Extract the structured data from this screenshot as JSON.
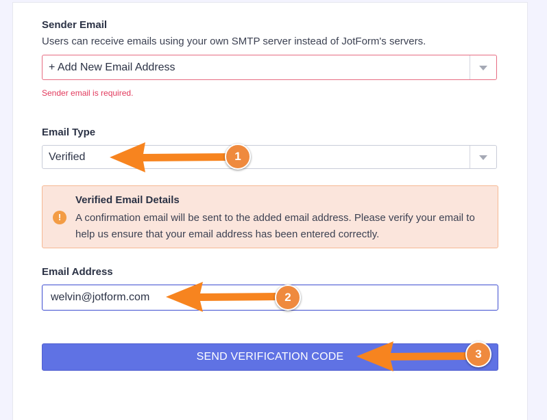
{
  "sender_email": {
    "label": "Sender Email",
    "description": "Users can receive emails using your own SMTP server instead of JotForm's servers.",
    "selected_value": "+ Add New Email Address",
    "error": "Sender email is required."
  },
  "email_type": {
    "label": "Email Type",
    "selected_value": "Verified"
  },
  "notice": {
    "title": "Verified Email Details",
    "body": "A confirmation email will be sent to the added email address. Please verify your email to help us ensure that your email address has been entered correctly.",
    "icon": "exclamation"
  },
  "email_address": {
    "label": "Email Address",
    "value": "welvin@jotform.com"
  },
  "send_button": {
    "label": "SEND VERIFICATION CODE"
  },
  "annotations": {
    "steps": [
      "1",
      "2",
      "3"
    ],
    "arrow_color": "#f7841f"
  },
  "colors": {
    "button": "#5f72e4",
    "error": "#e1395c",
    "notice_bg": "#fbe5dc",
    "notice_border": "#f6b893",
    "badge": "#ef8a3e"
  }
}
